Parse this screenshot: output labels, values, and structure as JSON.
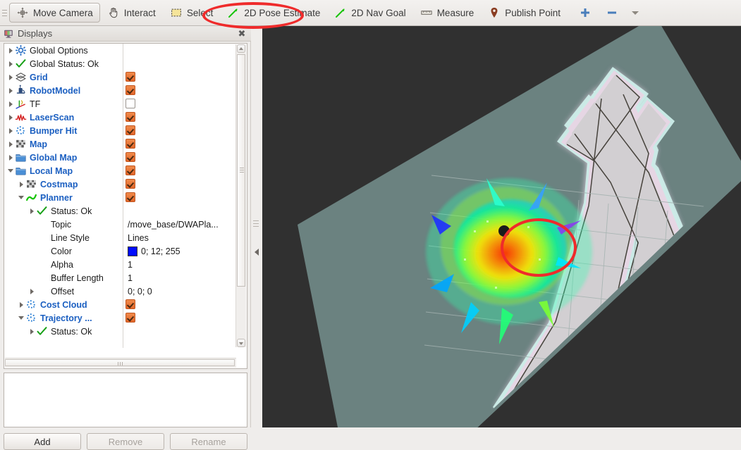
{
  "toolbar": {
    "items": [
      {
        "label": "Move Camera",
        "icon": "move-camera-icon",
        "active": true
      },
      {
        "label": "Interact",
        "icon": "hand-icon",
        "active": false
      },
      {
        "label": "Select",
        "icon": "select-rect-icon",
        "active": false
      },
      {
        "label": "2D Pose Estimate",
        "icon": "green-arrow-icon",
        "active": false
      },
      {
        "label": "2D Nav Goal",
        "icon": "green-arrow-icon",
        "active": false
      },
      {
        "label": "Measure",
        "icon": "ruler-icon",
        "active": false
      },
      {
        "label": "Publish Point",
        "icon": "map-pin-icon",
        "active": false
      }
    ],
    "add_tool_icon": "plus-icon",
    "remove_tool_icon": "minus-icon",
    "dropdown_icon": "chevron-down-icon"
  },
  "annotation": {
    "shape": "ellipse",
    "color": "#ef2b2b",
    "targets": [
      "2D Pose Estimate",
      "local-costmap-center"
    ]
  },
  "panel": {
    "title": "Displays",
    "title_icon": "displays-icon",
    "close_icon": "close-icon",
    "buttons": [
      {
        "label": "Add",
        "enabled": true
      },
      {
        "label": "Remove",
        "enabled": false
      },
      {
        "label": "Rename",
        "enabled": false
      }
    ]
  },
  "tree": {
    "rows": [
      {
        "indent": 0,
        "arrow": "closed",
        "icon": "gear-icon",
        "label": "Global Options",
        "style": "plain"
      },
      {
        "indent": 0,
        "arrow": "closed",
        "icon": "check-icon",
        "label": "Global Status: Ok",
        "style": "plain"
      },
      {
        "indent": 0,
        "arrow": "closed",
        "icon": "grid-icon",
        "label": "Grid",
        "style": "blue",
        "check": "on"
      },
      {
        "indent": 0,
        "arrow": "closed",
        "icon": "robot-icon",
        "label": "RobotModel",
        "style": "blue",
        "check": "on"
      },
      {
        "indent": 0,
        "arrow": "closed",
        "icon": "tf-axes-icon",
        "label": "TF",
        "style": "plain",
        "check": "off"
      },
      {
        "indent": 0,
        "arrow": "closed",
        "icon": "laserscan-icon",
        "label": "LaserScan",
        "style": "blue",
        "check": "on"
      },
      {
        "indent": 0,
        "arrow": "closed",
        "icon": "pointcloud-icon",
        "label": "Bumper Hit",
        "style": "blue",
        "check": "on"
      },
      {
        "indent": 0,
        "arrow": "closed",
        "icon": "map-icon",
        "label": "Map",
        "style": "blue",
        "check": "on"
      },
      {
        "indent": 0,
        "arrow": "closed",
        "icon": "folder-icon",
        "label": "Global Map",
        "style": "blue",
        "check": "on"
      },
      {
        "indent": 0,
        "arrow": "open",
        "icon": "folder-icon",
        "label": "Local Map",
        "style": "blue",
        "check": "on"
      },
      {
        "indent": 1,
        "arrow": "closed",
        "icon": "map-icon",
        "label": "Costmap",
        "style": "blue",
        "check": "on"
      },
      {
        "indent": 1,
        "arrow": "open",
        "icon": "path-icon",
        "label": "Planner",
        "style": "blue",
        "check": "on"
      },
      {
        "indent": 2,
        "arrow": "closed",
        "icon": "check-icon",
        "label": "Status: Ok",
        "style": "plain"
      },
      {
        "indent": 2,
        "arrow": "none",
        "icon": "none",
        "label": "Topic",
        "style": "plain",
        "value": "/move_base/DWAPla..."
      },
      {
        "indent": 2,
        "arrow": "none",
        "icon": "none",
        "label": "Line Style",
        "style": "plain",
        "value": "Lines"
      },
      {
        "indent": 2,
        "arrow": "none",
        "icon": "none",
        "label": "Color",
        "style": "plain",
        "value": "0; 12; 255",
        "swatch": "#000cff"
      },
      {
        "indent": 2,
        "arrow": "none",
        "icon": "none",
        "label": "Alpha",
        "style": "plain",
        "value": "1"
      },
      {
        "indent": 2,
        "arrow": "none",
        "icon": "none",
        "label": "Buffer Length",
        "style": "plain",
        "value": "1"
      },
      {
        "indent": 2,
        "arrow": "closed",
        "icon": "none",
        "label": "Offset",
        "style": "plain",
        "value": "0; 0; 0"
      },
      {
        "indent": 1,
        "arrow": "closed",
        "icon": "pointcloud-icon",
        "label": "Cost Cloud",
        "style": "blue",
        "check": "on"
      },
      {
        "indent": 1,
        "arrow": "open",
        "icon": "pointcloud-icon",
        "label": "Trajectory ...",
        "style": "blue",
        "check": "on"
      },
      {
        "indent": 2,
        "arrow": "closed",
        "icon": "check-icon",
        "label": "Status: Ok",
        "style": "plain"
      }
    ]
  },
  "viewport": {
    "background_color": "#303030",
    "map_plane_color": "#6b8280",
    "free_space_color": "#d4d1d4",
    "inflation_color": "#e8d6e2",
    "obstacle_outline_color": "#cfeeea",
    "grid_color": "#9aa9a7",
    "robot_marker_color": "#1c1c1c",
    "costmap_colors": [
      "#0000ff",
      "#00b7ff",
      "#00ff88",
      "#9dff00",
      "#ffd000",
      "#ff6a00",
      "#ff0000"
    ]
  }
}
